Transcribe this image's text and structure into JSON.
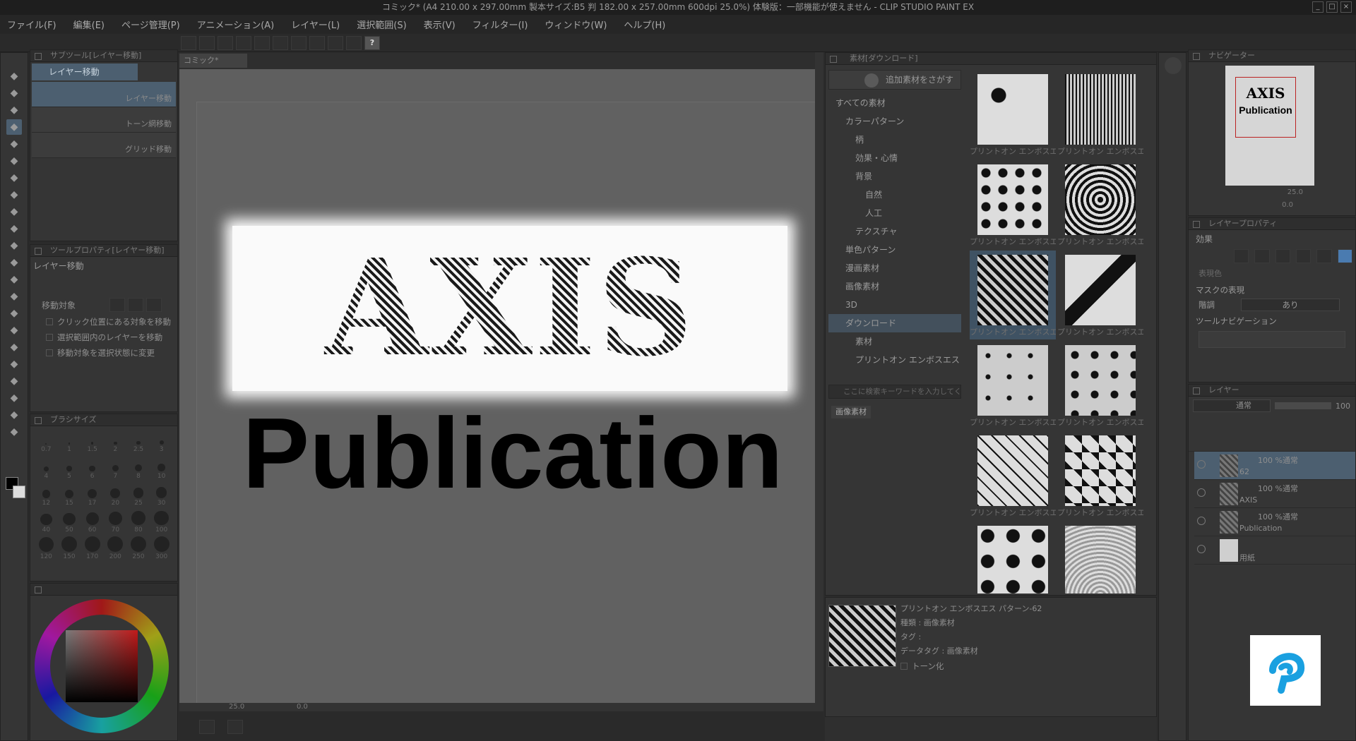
{
  "window": {
    "title": "コミック* (A4 210.00 x 297.00mm 製本サイズ:B5 判 182.00 x 257.00mm 600dpi 25.0%)  体験版：一部機能が使えません - CLIP STUDIO PAINT EX"
  },
  "menu": [
    "ファイル(F)",
    "編集(E)",
    "ページ管理(P)",
    "アニメーション(A)",
    "レイヤー(L)",
    "選択範囲(S)",
    "表示(V)",
    "フィルター(I)",
    "ウィンドウ(W)",
    "ヘルプ(H)"
  ],
  "subtool": {
    "header": "サブツール[レイヤー移動]",
    "tab": "レイヤー移動",
    "items": [
      "レイヤー移動",
      "トーン網移動",
      "グリッド移動"
    ]
  },
  "tool_property": {
    "header": "ツールプロパティ[レイヤー移動]",
    "title": "レイヤー移動",
    "move_target_label": "移動対象",
    "options": [
      "クリック位置にある対象を移動",
      "選択範囲内のレイヤーを移動",
      "移動対象を選択状態に変更"
    ]
  },
  "brush_size": {
    "header": "ブラシサイズ",
    "sizes": [
      "0.7",
      "1",
      "1.5",
      "2",
      "2.5",
      "3",
      "4",
      "5",
      "6",
      "7",
      "8",
      "10",
      "12",
      "15",
      "17",
      "20",
      "25",
      "30",
      "40",
      "50",
      "60",
      "70",
      "80",
      "100",
      "120",
      "150",
      "170",
      "200",
      "250",
      "300"
    ]
  },
  "canvas": {
    "tab": "コミック*",
    "zoom": "25.0",
    "angle": "0.0",
    "title_top": "AXIS",
    "title_bottom": "Publication"
  },
  "materials": {
    "header": "素材[ダウンロード]",
    "search_more": "追加素材をさがす",
    "tree": [
      {
        "label": "すべての素材",
        "indent": 0
      },
      {
        "label": "カラーパターン",
        "indent": 1
      },
      {
        "label": "柄",
        "indent": 2
      },
      {
        "label": "効果・心情",
        "indent": 2
      },
      {
        "label": "背景",
        "indent": 2
      },
      {
        "label": "自然",
        "indent": 3
      },
      {
        "label": "人工",
        "indent": 3
      },
      {
        "label": "テクスチャ",
        "indent": 2
      },
      {
        "label": "単色パターン",
        "indent": 1
      },
      {
        "label": "漫画素材",
        "indent": 1
      },
      {
        "label": "画像素材",
        "indent": 1
      },
      {
        "label": "3D",
        "indent": 1
      },
      {
        "label": "ダウンロード",
        "indent": 1
      },
      {
        "label": "素材",
        "indent": 2
      },
      {
        "label": "プリントオン エンボスエス パ",
        "indent": 2
      }
    ],
    "search_placeholder": "ここに検索キーワードを入力してください",
    "tag": "画像素材",
    "thumb_caption": "プリントオン エンボスエス パター",
    "detail": {
      "name": "プリントオン エンボスエス パターン-62",
      "kind": "種類 : 画像素材",
      "tag": "タグ :",
      "datatag": "データタグ : 画像素材",
      "tone": "トーン化"
    }
  },
  "navigator": {
    "header": "ナビゲーター",
    "zoom": "25.0",
    "angle": "0.0",
    "preview_top": "AXIS",
    "preview_bottom": "Publication"
  },
  "layer_property": {
    "header": "レイヤープロパティ",
    "effect_label": "効果",
    "display_color": "表現色",
    "mask_label": "マスクの表現",
    "tone_label": "階調",
    "tone_value": "あり",
    "navigation_label": "ツールナビゲーション"
  },
  "layers": {
    "header": "レイヤー",
    "blend_mode": "通常",
    "opacity": "100",
    "rows": [
      {
        "mode": "100 %通常",
        "name": "62"
      },
      {
        "mode": "100 %通常",
        "name": "AXIS"
      },
      {
        "mode": "100 %通常",
        "name": "Publication"
      },
      {
        "mode": "",
        "name": "用紙"
      }
    ]
  },
  "colors": {
    "accent": "#4aa3df",
    "selected": "#4c5f70"
  },
  "icons": [
    "zoom-icon",
    "hand-icon",
    "rotate-icon",
    "move-icon",
    "select-icon",
    "lasso-icon",
    "eyedropper-icon",
    "pen-icon",
    "pencil-icon",
    "brush-icon",
    "airbrush-icon",
    "decoration-icon",
    "eraser-icon",
    "blend-icon",
    "fill-icon",
    "gradient-icon",
    "figure-icon",
    "frame-icon",
    "ruler-icon",
    "text-icon",
    "balloon-icon",
    "line-correction-icon"
  ]
}
